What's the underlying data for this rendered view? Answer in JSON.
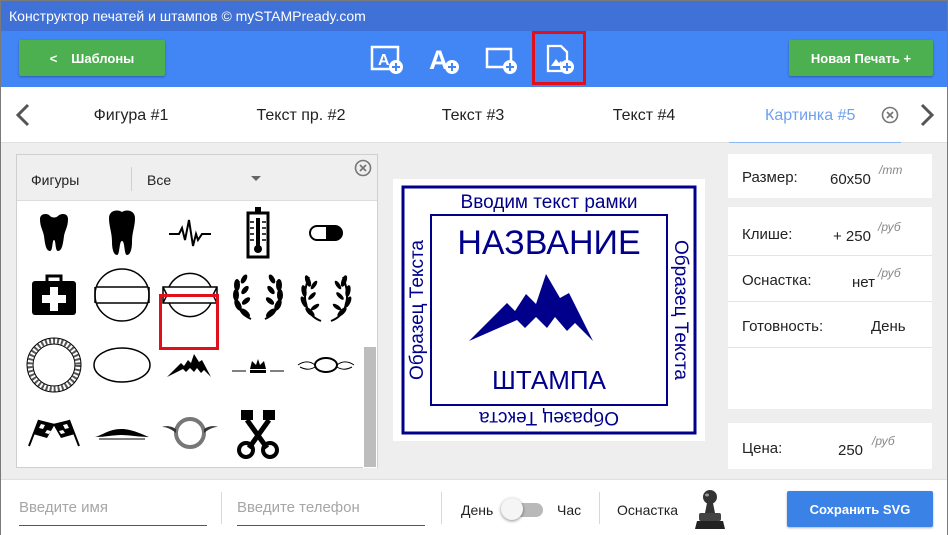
{
  "window": {
    "title": "Конструктор печатей и штампов © mySTAMPready.com"
  },
  "toolbar": {
    "templates_label": "Шаблоны",
    "templates_chevron": "<",
    "new_stamp_label": "Новая Печать +",
    "tools": [
      {
        "icon": "add-text-frame-icon"
      },
      {
        "icon": "add-text-icon"
      },
      {
        "icon": "add-shape-icon"
      },
      {
        "icon": "add-image-icon",
        "highlighted": true
      }
    ]
  },
  "tabs": {
    "items": [
      {
        "label": "Фигура #1"
      },
      {
        "label": "Текст пр. #2"
      },
      {
        "label": "Текст #3"
      },
      {
        "label": "Текст #4"
      },
      {
        "label": "Картинка #5",
        "active": true
      }
    ]
  },
  "shapes_panel": {
    "category_label": "Фигуры",
    "filter_value": "Все",
    "items": [
      "molar-tooth-icon",
      "tooth-icon",
      "heartbeat-icon",
      "thermometer-icon",
      "pill-icon",
      "first-aid-kit-icon",
      "oval-banner-icon",
      "circle-banner-icon",
      "laurel-wreath-icon",
      "laurel-wreath-open-icon",
      "rope-wreath-icon",
      "ellipse-icon",
      "mountain-icon",
      "crown-ornament-icon",
      "oval-ornament-icon",
      "checkered-flags-icon",
      "car-silhouette-icon",
      "winged-circle-icon",
      "crossed-pistons-icon"
    ],
    "selected_item": "mountain-icon"
  },
  "stamp": {
    "top_text": "Вводим текст рамки",
    "left_text": "Образец Текста",
    "right_text": "Образец Текста",
    "bottom_text": "Образец Текста",
    "title": "НАЗВАНИЕ",
    "subtitle": "ШТАМПА",
    "color": "#00008b"
  },
  "info": {
    "size_label": "Размер:",
    "size_value": "60x50",
    "size_unit": "/mm",
    "cliche_label": "Клише:",
    "cliche_value": "+ 250",
    "cliche_unit": "/руб",
    "mount_label": "Оснастка:",
    "mount_value": "нет",
    "mount_unit": "/руб",
    "ready_label": "Готовность:",
    "ready_value": "День",
    "price_label": "Цена:",
    "price_value": "250",
    "price_unit": "/руб"
  },
  "bottom": {
    "name_placeholder": "Введите имя",
    "phone_placeholder": "Введите телефон",
    "toggle_left": "День",
    "toggle_right": "Час",
    "mount_label": "Оснастка",
    "save_label": "Сохранить SVG"
  },
  "colors": {
    "titlebar": "#3f71d7",
    "toolbar": "#4285f4",
    "green_button": "#4caf50",
    "save_button": "#3b82e6",
    "highlight": "#e0101a",
    "active_tab": "#6fa0f0"
  }
}
